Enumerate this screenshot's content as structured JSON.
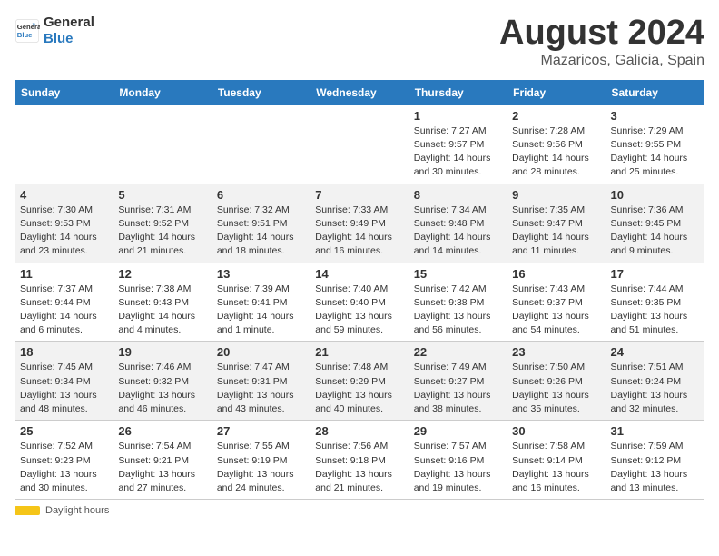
{
  "logo": {
    "line1": "General",
    "line2": "Blue"
  },
  "title": "August 2024",
  "location": "Mazaricos, Galicia, Spain",
  "days_of_week": [
    "Sunday",
    "Monday",
    "Tuesday",
    "Wednesday",
    "Thursday",
    "Friday",
    "Saturday"
  ],
  "weeks": [
    [
      {
        "day": "",
        "info": ""
      },
      {
        "day": "",
        "info": ""
      },
      {
        "day": "",
        "info": ""
      },
      {
        "day": "",
        "info": ""
      },
      {
        "day": "1",
        "info": "Sunrise: 7:27 AM\nSunset: 9:57 PM\nDaylight: 14 hours\nand 30 minutes."
      },
      {
        "day": "2",
        "info": "Sunrise: 7:28 AM\nSunset: 9:56 PM\nDaylight: 14 hours\nand 28 minutes."
      },
      {
        "day": "3",
        "info": "Sunrise: 7:29 AM\nSunset: 9:55 PM\nDaylight: 14 hours\nand 25 minutes."
      }
    ],
    [
      {
        "day": "4",
        "info": "Sunrise: 7:30 AM\nSunset: 9:53 PM\nDaylight: 14 hours\nand 23 minutes."
      },
      {
        "day": "5",
        "info": "Sunrise: 7:31 AM\nSunset: 9:52 PM\nDaylight: 14 hours\nand 21 minutes."
      },
      {
        "day": "6",
        "info": "Sunrise: 7:32 AM\nSunset: 9:51 PM\nDaylight: 14 hours\nand 18 minutes."
      },
      {
        "day": "7",
        "info": "Sunrise: 7:33 AM\nSunset: 9:49 PM\nDaylight: 14 hours\nand 16 minutes."
      },
      {
        "day": "8",
        "info": "Sunrise: 7:34 AM\nSunset: 9:48 PM\nDaylight: 14 hours\nand 14 minutes."
      },
      {
        "day": "9",
        "info": "Sunrise: 7:35 AM\nSunset: 9:47 PM\nDaylight: 14 hours\nand 11 minutes."
      },
      {
        "day": "10",
        "info": "Sunrise: 7:36 AM\nSunset: 9:45 PM\nDaylight: 14 hours\nand 9 minutes."
      }
    ],
    [
      {
        "day": "11",
        "info": "Sunrise: 7:37 AM\nSunset: 9:44 PM\nDaylight: 14 hours\nand 6 minutes."
      },
      {
        "day": "12",
        "info": "Sunrise: 7:38 AM\nSunset: 9:43 PM\nDaylight: 14 hours\nand 4 minutes."
      },
      {
        "day": "13",
        "info": "Sunrise: 7:39 AM\nSunset: 9:41 PM\nDaylight: 14 hours\nand 1 minute."
      },
      {
        "day": "14",
        "info": "Sunrise: 7:40 AM\nSunset: 9:40 PM\nDaylight: 13 hours\nand 59 minutes."
      },
      {
        "day": "15",
        "info": "Sunrise: 7:42 AM\nSunset: 9:38 PM\nDaylight: 13 hours\nand 56 minutes."
      },
      {
        "day": "16",
        "info": "Sunrise: 7:43 AM\nSunset: 9:37 PM\nDaylight: 13 hours\nand 54 minutes."
      },
      {
        "day": "17",
        "info": "Sunrise: 7:44 AM\nSunset: 9:35 PM\nDaylight: 13 hours\nand 51 minutes."
      }
    ],
    [
      {
        "day": "18",
        "info": "Sunrise: 7:45 AM\nSunset: 9:34 PM\nDaylight: 13 hours\nand 48 minutes."
      },
      {
        "day": "19",
        "info": "Sunrise: 7:46 AM\nSunset: 9:32 PM\nDaylight: 13 hours\nand 46 minutes."
      },
      {
        "day": "20",
        "info": "Sunrise: 7:47 AM\nSunset: 9:31 PM\nDaylight: 13 hours\nand 43 minutes."
      },
      {
        "day": "21",
        "info": "Sunrise: 7:48 AM\nSunset: 9:29 PM\nDaylight: 13 hours\nand 40 minutes."
      },
      {
        "day": "22",
        "info": "Sunrise: 7:49 AM\nSunset: 9:27 PM\nDaylight: 13 hours\nand 38 minutes."
      },
      {
        "day": "23",
        "info": "Sunrise: 7:50 AM\nSunset: 9:26 PM\nDaylight: 13 hours\nand 35 minutes."
      },
      {
        "day": "24",
        "info": "Sunrise: 7:51 AM\nSunset: 9:24 PM\nDaylight: 13 hours\nand 32 minutes."
      }
    ],
    [
      {
        "day": "25",
        "info": "Sunrise: 7:52 AM\nSunset: 9:23 PM\nDaylight: 13 hours\nand 30 minutes."
      },
      {
        "day": "26",
        "info": "Sunrise: 7:54 AM\nSunset: 9:21 PM\nDaylight: 13 hours\nand 27 minutes."
      },
      {
        "day": "27",
        "info": "Sunrise: 7:55 AM\nSunset: 9:19 PM\nDaylight: 13 hours\nand 24 minutes."
      },
      {
        "day": "28",
        "info": "Sunrise: 7:56 AM\nSunset: 9:18 PM\nDaylight: 13 hours\nand 21 minutes."
      },
      {
        "day": "29",
        "info": "Sunrise: 7:57 AM\nSunset: 9:16 PM\nDaylight: 13 hours\nand 19 minutes."
      },
      {
        "day": "30",
        "info": "Sunrise: 7:58 AM\nSunset: 9:14 PM\nDaylight: 13 hours\nand 16 minutes."
      },
      {
        "day": "31",
        "info": "Sunrise: 7:59 AM\nSunset: 9:12 PM\nDaylight: 13 hours\nand 13 minutes."
      }
    ]
  ],
  "footer": {
    "daylight_label": "Daylight hours"
  }
}
